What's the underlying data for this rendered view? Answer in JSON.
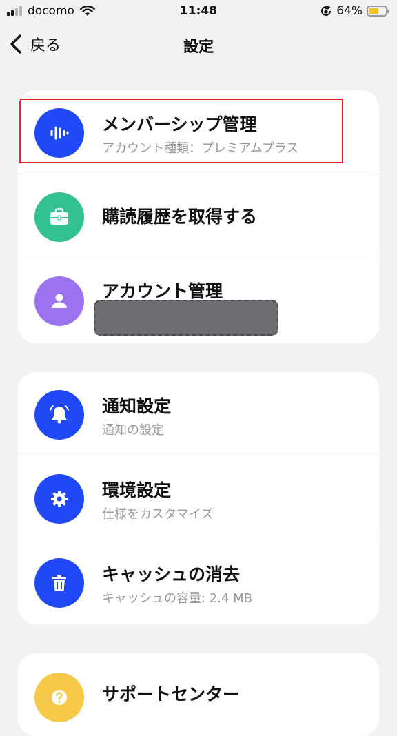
{
  "status_bar": {
    "carrier": "docomo",
    "time": "11:48",
    "battery_percent": "64%",
    "battery_level": 0.64,
    "battery_color": "#f5c518"
  },
  "nav": {
    "back_label": "戻る",
    "title": "設定"
  },
  "colors": {
    "blue": "#2048f5",
    "green": "#33c28f",
    "purple": "#9b72f0",
    "yellow": "#f7c948",
    "highlight": "#e0262d"
  },
  "sections": {
    "account": [
      {
        "title": "メンバーシップ管理",
        "subtitle": "アカウント種類：プレミアムプラス",
        "icon": "sound-wave-icon"
      },
      {
        "title": "購読履歴を取得する",
        "icon": "briefcase-icon"
      },
      {
        "title": "アカウント管理",
        "icon": "person-icon"
      }
    ],
    "settings": [
      {
        "title": "通知設定",
        "subtitle": "通知の設定",
        "icon": "bell-icon"
      },
      {
        "title": "環境設定",
        "subtitle": "仕様をカスタマイズ",
        "icon": "gear-icon"
      },
      {
        "title": "キャッシュの消去",
        "subtitle": "キャッシュの容量: 2.4 MB",
        "icon": "trash-icon"
      }
    ],
    "support": [
      {
        "title": "サポートセンター",
        "icon": "question-icon"
      }
    ]
  }
}
